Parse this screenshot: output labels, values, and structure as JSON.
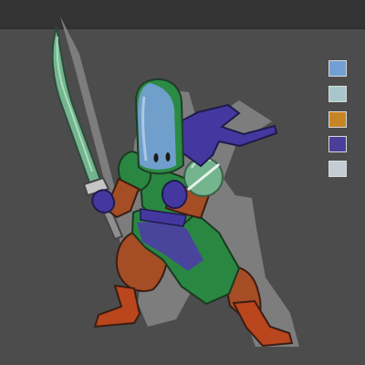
{
  "palette": {
    "swatches": [
      {
        "name": "light-blue",
        "color": "#73a0d3"
      },
      {
        "name": "pale-teal",
        "color": "#a8c7cd"
      },
      {
        "name": "ochre",
        "color": "#c68626"
      },
      {
        "name": "indigo",
        "color": "#4a3f99"
      },
      {
        "name": "light-gray",
        "color": "#c4cdd3"
      }
    ]
  },
  "artwork_colors": {
    "background": "#4b4b4b",
    "top_bar": "#333333",
    "green": "#2e8b45",
    "blue": "#5a4ab0",
    "brown": "#b84a1f",
    "blade": "#7fc29c",
    "shadow": "#7d7d7d"
  }
}
